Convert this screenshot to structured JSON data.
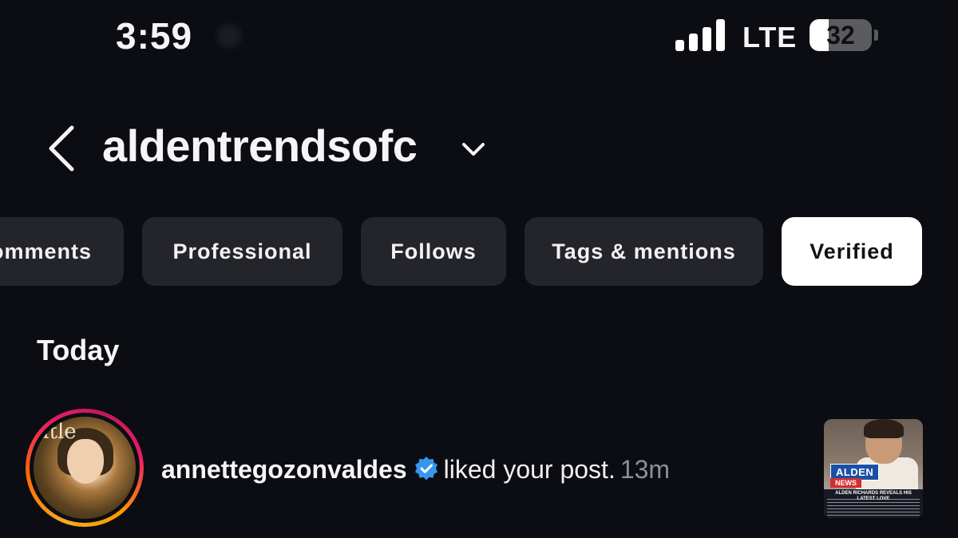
{
  "status_bar": {
    "time": "3:59",
    "network": "LTE",
    "battery": "32",
    "battery_level": 0.32,
    "signal_bars": 4
  },
  "header": {
    "username": "aldentrendsofc"
  },
  "filter_tabs": [
    {
      "label": "omments"
    },
    {
      "label": "Professional"
    },
    {
      "label": "Follows"
    },
    {
      "label": "Tags & mentions"
    },
    {
      "label": "Verified",
      "selected": true
    }
  ],
  "section": {
    "title": "Today"
  },
  "notifications": [
    {
      "username": "annettegozonvaldes",
      "verified": true,
      "action": "liked your post.",
      "time": "13m",
      "avatar_text": "atle",
      "thumbnail": {
        "logo_top": "ALDEN",
        "logo_bottom": "NEWS",
        "headline": "ALDEN RICHARDS REVEALS HIS LATEST LOVE"
      }
    }
  ],
  "colors": {
    "background": "#0b0d12",
    "chip": "#23252b",
    "chip_active": "#ffffff",
    "verified_badge": "#3797f0"
  }
}
